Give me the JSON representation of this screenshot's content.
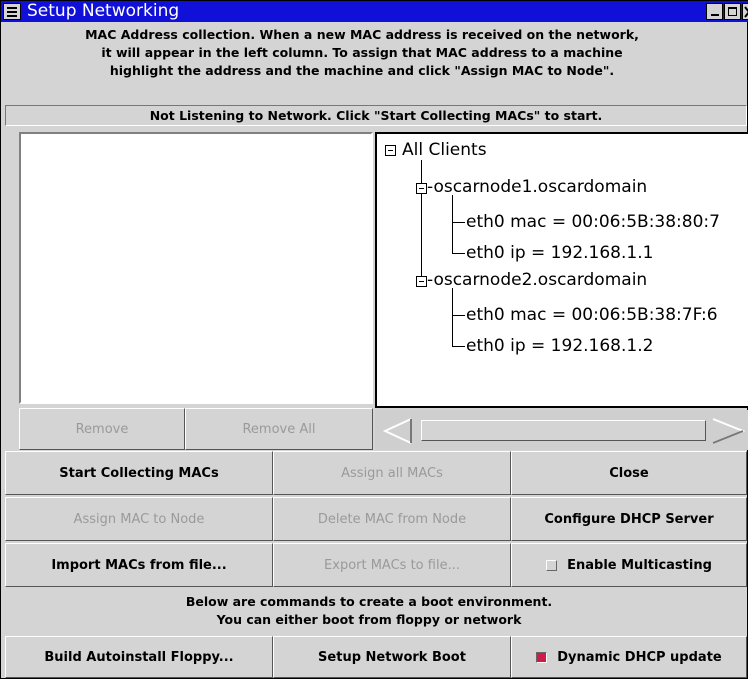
{
  "window": {
    "title": "Setup Networking",
    "controls": [
      "minimize-icon",
      "maximize-icon",
      "close-icon"
    ]
  },
  "instructions": {
    "line1": "MAC Address collection.  When a new MAC address is received on the network,",
    "line2": "it will appear in the left column.  To assign that MAC address to a machine",
    "line3": "highlight the address and the machine and click \"Assign MAC to Node\"."
  },
  "status": {
    "text": "Not Listening to Network. Click \"Start Collecting MACs\" to start."
  },
  "tree": {
    "root": "All Clients",
    "nodes": [
      {
        "label": "-oscarnode1.oscardomain",
        "children": [
          "eth0 mac = 00:06:5B:38:80:7",
          "eth0 ip = 192.168.1.1"
        ]
      },
      {
        "label": "-oscarnode2.oscardomain",
        "children": [
          "eth0 mac = 00:06:5B:38:7F:6",
          "eth0 ip = 192.168.1.2"
        ]
      }
    ]
  },
  "list_buttons": {
    "remove": "Remove",
    "remove_all": "Remove All"
  },
  "actions": {
    "start_collecting": "Start Collecting MACs",
    "assign_all": "Assign all MACs",
    "close": "Close",
    "assign_mac": "Assign MAC to Node",
    "delete_mac": "Delete MAC from Node",
    "configure_dhcp": "Configure DHCP Server",
    "import_macs": "Import MACs from file...",
    "export_macs": "Export MACs to file...",
    "enable_multicasting": "Enable Multicasting",
    "enable_multicasting_checked": false
  },
  "commands": {
    "line1": "Below are commands to create a boot environment.",
    "line2": "You can either boot from floppy or network"
  },
  "boot": {
    "build_floppy": "Build Autoinstall Floppy...",
    "network_boot": "Setup Network Boot",
    "dynamic_dhcp": "Dynamic DHCP update",
    "dynamic_dhcp_checked": true
  },
  "colors": {
    "title_bar": "#1010d8",
    "check_accent": "#d01a4a",
    "disabled_text": "#9a9a9a"
  }
}
